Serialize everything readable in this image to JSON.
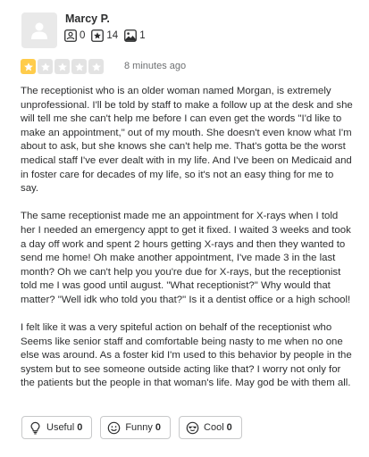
{
  "user": {
    "name": "Marcy P.",
    "friends_count": "0",
    "reviews_count": "14",
    "photos_count": "1",
    "icons": [
      "avatar-placeholder-icon",
      "friends-icon",
      "reviews-star-icon",
      "photos-icon"
    ]
  },
  "rating": {
    "value": 1,
    "max": 5,
    "filled_color": "#ffcc4b",
    "empty_color": "#e3e3e3"
  },
  "timestamp": "8 minutes ago",
  "review": {
    "paragraphs": [
      "The receptionist who is an older woman named Morgan, is extremely unprofessional. I'll be told by staff to make a follow up at the desk and she will tell me she can't help me before I can even get the words \"I'd like to make an appointment,\" out of my mouth. She doesn't even know what I'm about to ask, but she knows she can't help me. That's gotta be the worst medical staff I've ever dealt with in my life. And I've been on Medicaid and in foster care for decades of my life, so it's not an easy thing for me to say.",
      "The same receptionist made me an appointment for X-rays when I told her I needed an emergency appt to get it fixed. I waited 3 weeks and took a day off work and spent 2 hours getting X-rays and then they wanted to send me home! Oh make another appointment, I've made 3 in the last month? Oh we can't help you you're due for X-rays, but the receptionist told me I was good until august. \"What receptionist?\" Why would that matter? \"Well idk who told you that?\" Is it a dentist office or a high school!",
      "I felt like it was a very spiteful action on behalf of the receptionist who Seems like senior staff and comfortable being nasty to me when no one else was around. As a foster kid I'm used to this behavior by people in the system but to see someone outside acting like that? I worry not only for the patients but the people in that woman's life. May god be with them all."
    ]
  },
  "reactions": {
    "useful": {
      "label": "Useful",
      "count": "0",
      "icon": "lightbulb-icon"
    },
    "funny": {
      "label": "Funny",
      "count": "0",
      "icon": "smiley-icon"
    },
    "cool": {
      "label": "Cool",
      "count": "0",
      "icon": "sunglasses-icon"
    }
  }
}
